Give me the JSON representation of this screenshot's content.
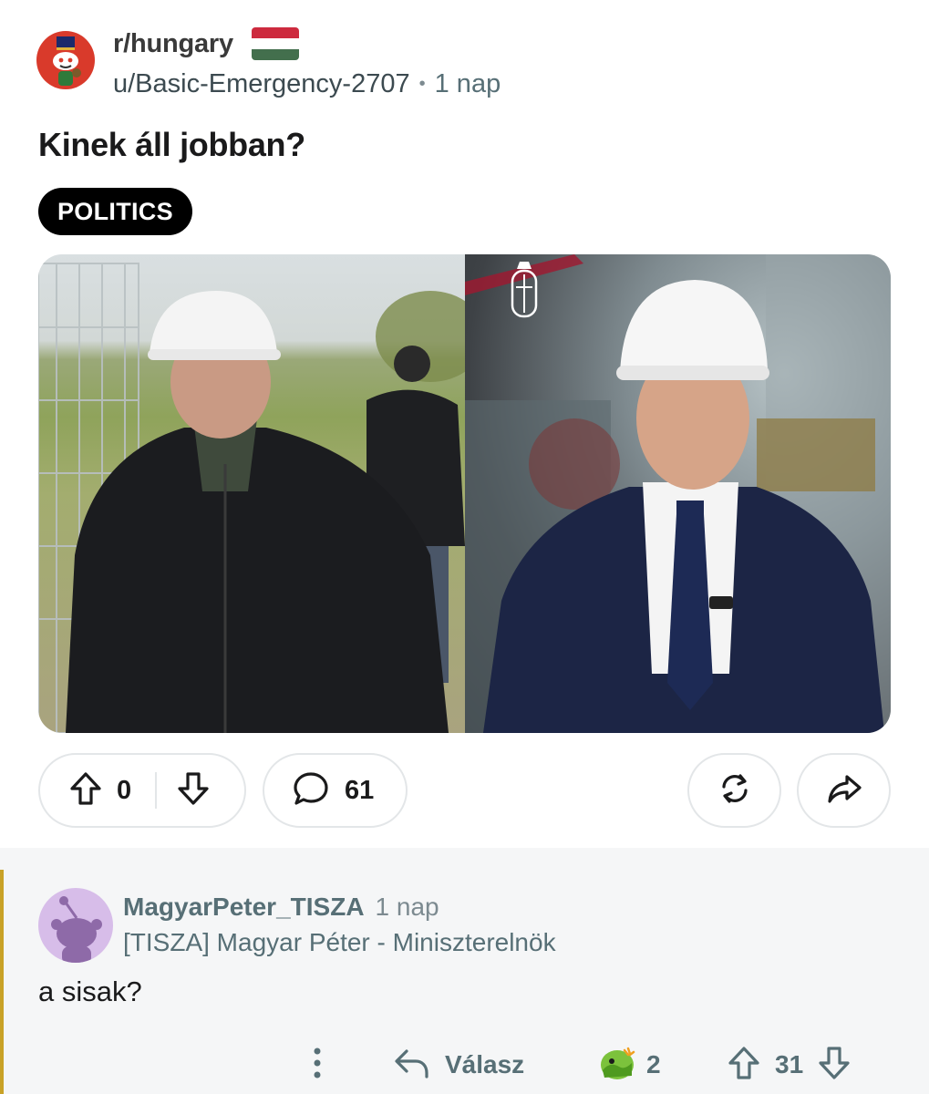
{
  "post": {
    "subreddit": "r/hungary",
    "author": "u/Basic-Emergency-2707",
    "separator": "•",
    "time": "1 nap",
    "title": "Kinek áll jobban?",
    "flair": "POLITICS",
    "flag_colors": [
      "#cd2a3e",
      "#ffffff",
      "#436f4d"
    ]
  },
  "actions": {
    "score": "0",
    "comments": "61"
  },
  "comment": {
    "author": "MagyarPeter_TISZA",
    "time": "1 nap",
    "user_flair": "[TISZA] Magyar Péter - Miniszterelnök",
    "body": "a sisak?",
    "reply_label": "Válasz",
    "awards": "2",
    "score": "31"
  },
  "colors": {
    "flair_bg": "#000000",
    "comment_accent": "#c9a227",
    "subreddit_avatar": "#d93a2b",
    "comment_avatar": "#d7bde9"
  }
}
